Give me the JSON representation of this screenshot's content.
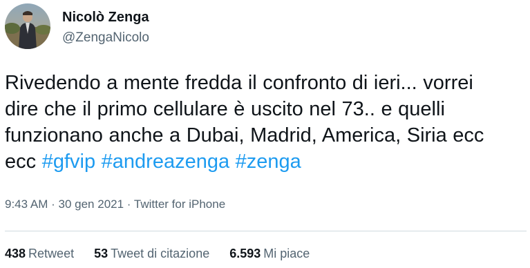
{
  "author": {
    "name": "Nicolò Zenga",
    "handle": "@ZengaNicolo"
  },
  "tweet": {
    "line1": "Rivedendo a mente fredda il confronto di ieri... vorrei",
    "line2": "dire che il primo cellulare è uscito nel 73.. e quelli",
    "line3": "funzionano anche a Dubai, Madrid, America, Siria ecc",
    "line4_prefix": "ecc",
    "hashtags": [
      "#gfvip",
      "#andreazenga",
      "#zenga"
    ]
  },
  "meta": {
    "time": "9:43 AM",
    "separator": "·",
    "date": "30 gen 2021",
    "source": "Twitter for iPhone"
  },
  "stats": {
    "retweets_count": "438",
    "retweets_label": "Retweet",
    "quotes_count": "53",
    "quotes_label": "Tweet di citazione",
    "likes_count": "6.593",
    "likes_label": "Mi piace"
  },
  "colors": {
    "link": "#1d9bf0",
    "text": "#0f1419",
    "secondary": "#536471"
  },
  "icons": {
    "avatar": "profile-photo"
  }
}
